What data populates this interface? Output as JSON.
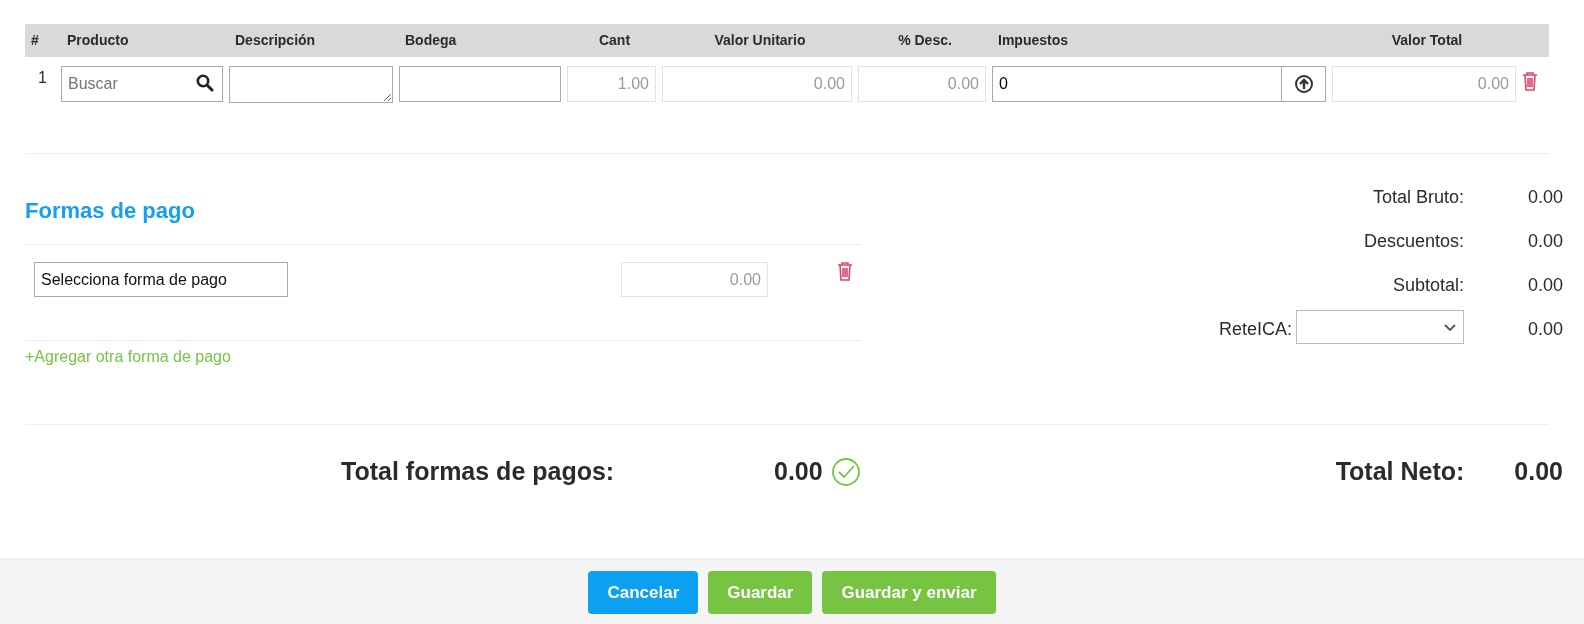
{
  "table": {
    "columns": [
      "#",
      "Producto",
      "Descripción",
      "Bodega",
      "Cant",
      "Valor Unitario",
      "% Desc.",
      "Impuestos",
      "Valor Total"
    ],
    "rows": [
      {
        "number": "1",
        "product_placeholder": "Buscar",
        "quantity": "1.00",
        "unit_value": "0.00",
        "discount": "0.00",
        "taxes": "0",
        "total": "0.00"
      }
    ]
  },
  "payments": {
    "title": "Formas de pago",
    "items": [
      {
        "method": "Selecciona forma de pago",
        "amount": "0.00"
      }
    ],
    "add_link": "+Agregar otra forma de pago"
  },
  "summary": [
    {
      "kind": "text",
      "label": "Total Bruto:",
      "value": "0.00"
    },
    {
      "kind": "text",
      "label": "Descuentos:",
      "value": "0.00"
    },
    {
      "kind": "text",
      "label": "Subtotal:",
      "value": "0.00"
    },
    {
      "kind": "select",
      "label": "ReteICA:",
      "value": "0.00"
    }
  ],
  "totals": {
    "payments_label": "Total formas de pagos:",
    "payments_value": "0.00",
    "payments_valid": true,
    "net_label": "Total Neto:",
    "net_value": "0.00"
  },
  "buttons": [
    {
      "label": "Cancelar",
      "kind": "primary"
    },
    {
      "label": "Guardar",
      "kind": "success"
    },
    {
      "label": "Guardar y enviar",
      "kind": "success"
    }
  ]
}
